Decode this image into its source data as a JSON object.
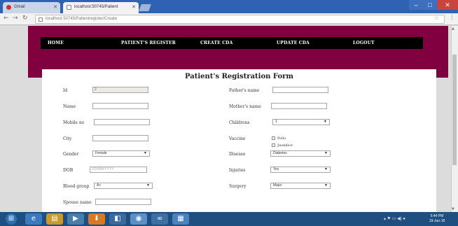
{
  "browser": {
    "tabs": [
      {
        "label": "Gmail"
      },
      {
        "label": "localhost:50745/Patient"
      }
    ],
    "address": "localhost:50745/Patientregister/Create"
  },
  "nav": {
    "items": [
      {
        "label": "HOME"
      },
      {
        "label": "PATIENT'S REGISTER"
      },
      {
        "label": "CREATE CDA"
      },
      {
        "label": "UPDATE CDA"
      },
      {
        "label": "LOGOUT"
      }
    ]
  },
  "form": {
    "title": "Patient's Registration Form",
    "id": {
      "label": "Id",
      "value": "2"
    },
    "name": {
      "label": "Name",
      "value": ""
    },
    "mobile": {
      "label": "Mobile no",
      "value": ""
    },
    "city": {
      "label": "City",
      "value": ""
    },
    "gender": {
      "label": "Gender",
      "value": "Female"
    },
    "dob": {
      "label": "DOB",
      "placeholder": "DD/MM/YYYY"
    },
    "blood_group": {
      "label": "Blood group",
      "value": "A+"
    },
    "spouse": {
      "label": "Spouse name",
      "value": ""
    },
    "father": {
      "label": "Father's name",
      "value": ""
    },
    "mother": {
      "label": "Mother's name",
      "value": ""
    },
    "childrens": {
      "label": "Childrens",
      "value": "1"
    },
    "vaccine": {
      "label": "Vaccine",
      "options": [
        "Polio",
        "Jaundice"
      ]
    },
    "disease": {
      "label": "Disease",
      "value": "Diabetes"
    },
    "injuries": {
      "label": "Injuries",
      "value": "Yes"
    },
    "surgery": {
      "label": "Surgery",
      "value": "Major"
    }
  },
  "taskbar": {
    "clock_time": "5:44 PM",
    "clock_date": "19-Jun-18"
  },
  "colors": {
    "header_maroon": "#800040",
    "navbar": "#000000",
    "taskbar": "#1e4f80"
  }
}
